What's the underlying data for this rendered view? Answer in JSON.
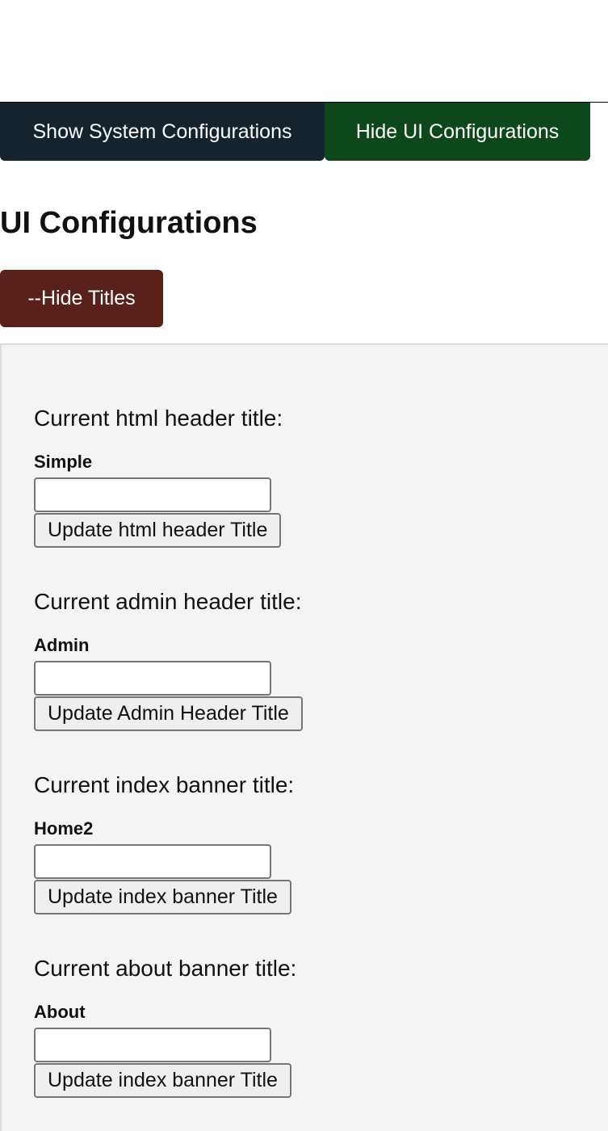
{
  "toggles": {
    "system_label": "Show System Configurations",
    "ui_label": "Hide UI Configurations"
  },
  "section": {
    "title": "UI Configurations",
    "hide_titles_label": "--Hide Titles"
  },
  "groups": [
    {
      "label": "Current html header title:",
      "value": "Simple",
      "input_value": "",
      "button_label": "Update html header Title"
    },
    {
      "label": "Current admin header title:",
      "value": "Admin",
      "input_value": "",
      "button_label": "Update Admin Header Title"
    },
    {
      "label": "Current index banner title:",
      "value": "Home2",
      "input_value": "",
      "button_label": "Update index banner Title"
    },
    {
      "label": "Current about banner title:",
      "value": "About",
      "input_value": "",
      "button_label": "Update index banner Title"
    }
  ],
  "colors": {
    "system_button": "#16232d",
    "ui_button": "#0e4719",
    "hide_titles_button": "#5a211b",
    "panel_background": "#f4f4f4"
  }
}
